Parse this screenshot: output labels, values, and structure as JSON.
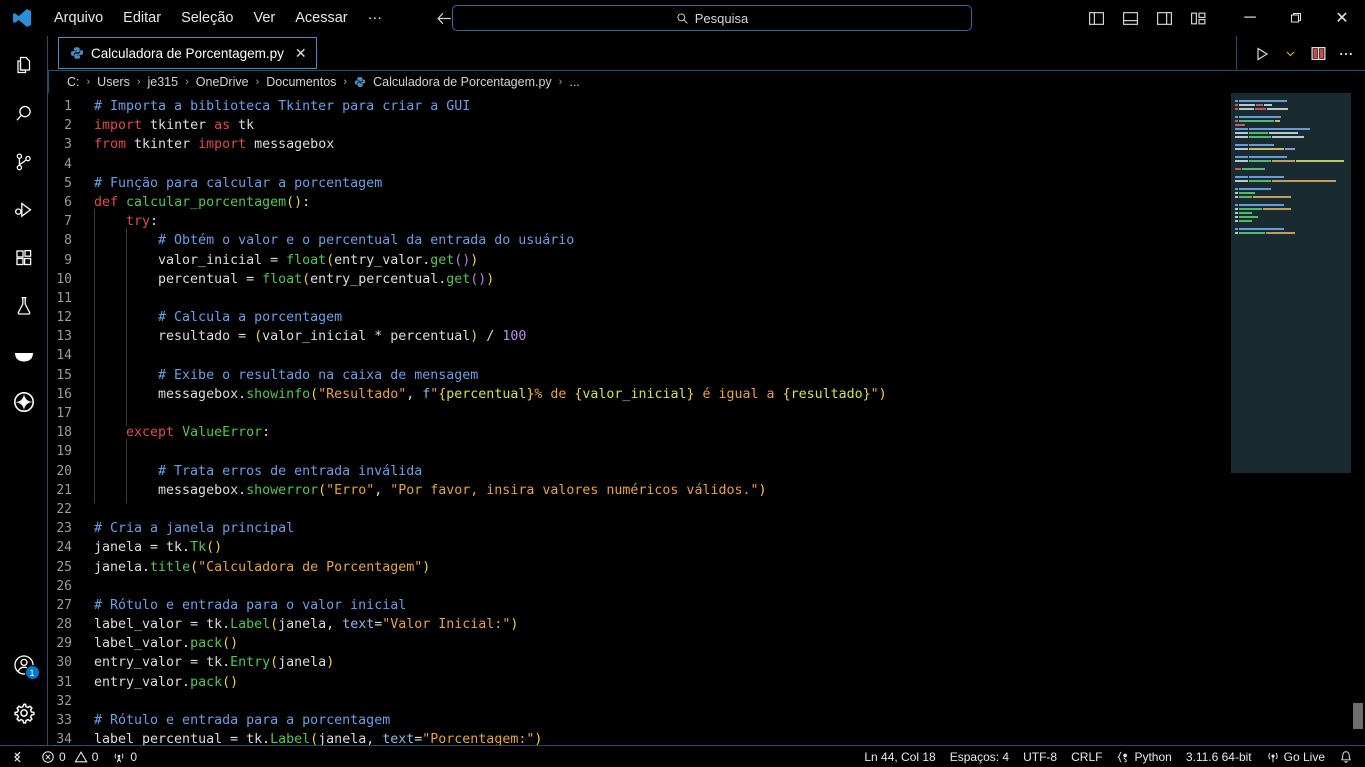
{
  "window": {
    "logo": "vscode-logo",
    "menu": [
      "Arquivo",
      "Editar",
      "Seleção",
      "Ver",
      "Acessar",
      "···"
    ],
    "nav": {
      "back": "back-arrow",
      "forward": "forward-arrow"
    },
    "search": {
      "placeholder": "Pesquisa",
      "value": "Pesquisa",
      "icon": "search-icon"
    },
    "layout_toggles": [
      {
        "name": "toggle-primary-sidebar",
        "label": "Alternar Barra Lateral Primária"
      },
      {
        "name": "toggle-panel",
        "label": "Alternar Painel"
      },
      {
        "name": "toggle-secondary-sidebar",
        "label": "Alternar Barra Lateral Secundária"
      },
      {
        "name": "customize-layout",
        "label": "Personalizar Layout"
      }
    ],
    "controls": {
      "minimize": "─",
      "maximize": "❐",
      "close": "✕"
    }
  },
  "activitybar": {
    "items": [
      {
        "name": "explorer",
        "icon": "files-icon",
        "label": "Explorador"
      },
      {
        "name": "search",
        "icon": "search-icon",
        "label": "Pesquisar"
      },
      {
        "name": "source-control",
        "icon": "source-control-icon",
        "label": "Controle do Código-Fonte"
      },
      {
        "name": "run-debug",
        "icon": "run-and-debug-icon",
        "label": "Executar e Depurar"
      },
      {
        "name": "extensions",
        "icon": "extensions-icon",
        "label": "Extensões"
      },
      {
        "name": "testing",
        "icon": "beaker-icon",
        "label": "Testes"
      },
      {
        "name": "docker",
        "icon": "docker-whale-icon",
        "label": "Docker"
      },
      {
        "name": "azure",
        "icon": "azure-swirl-icon",
        "label": "Azure"
      }
    ],
    "bottom": [
      {
        "name": "accounts",
        "icon": "account-icon",
        "label": "Contas",
        "badge": "1"
      },
      {
        "name": "settings",
        "icon": "gear-icon",
        "label": "Gerenciar"
      }
    ]
  },
  "tabs": [
    {
      "label": "Calculadora de Porcentagem.py",
      "icon": "python-file-icon",
      "close": "✕",
      "active": true
    }
  ],
  "editor_actions": [
    {
      "name": "run-python-file",
      "icon": "play-icon"
    },
    {
      "name": "run-options-dropdown",
      "icon": "chevron-down-icon"
    },
    {
      "name": "split-editor-right",
      "icon": "split-editor-icon"
    },
    {
      "name": "more-actions",
      "icon": "ellipsis-icon"
    }
  ],
  "breadcrumbs": {
    "items": [
      "C:",
      "Users",
      "je315",
      "OneDrive",
      "Documentos",
      "Calculadora de Porcentagem.py",
      "..."
    ],
    "separator": "›",
    "file_icon": "python-file-icon"
  },
  "statusbar": {
    "remote_icon": "remote-indicator-icon",
    "problems": {
      "error_icon": "error-icon",
      "errors": "0",
      "warning_icon": "warning-icon",
      "warnings": "0"
    },
    "ports": {
      "icon": "ports-icon",
      "count": "0"
    },
    "cursor": "Ln 44, Col 18",
    "indent": "Espaços: 4",
    "encoding": "UTF-8",
    "eol": "CRLF",
    "language": "Python",
    "language_icon": "python-brackets-icon",
    "interpreter": "3.11.6 64-bit",
    "golive": "Go Live",
    "golive_icon": "broadcast-icon",
    "notifications_icon": "bell-icon"
  },
  "colors": {
    "accent": "#0078d4",
    "tab_border": "#3d8ec9",
    "panel_border": "#1d4f6e",
    "background": "#000000",
    "comment": "#6a9fe8",
    "keyword": "#e04a4a",
    "function": "#4ec94e",
    "string": "#e8a33d",
    "number": "#b98cf0",
    "bracket": "#f2d13b",
    "fstring_expr": "#d7e04a"
  },
  "code": {
    "language": "python",
    "first_line": 1,
    "lines": [
      {
        "n": 1,
        "indent": 0,
        "tokens": [
          [
            "com",
            "# Importa a biblioteca Tkinter para criar a GUI"
          ]
        ]
      },
      {
        "n": 2,
        "indent": 0,
        "tokens": [
          [
            "kw",
            "import"
          ],
          [
            "pln",
            " tkinter "
          ],
          [
            "kw",
            "as"
          ],
          [
            "pln",
            " tk"
          ]
        ]
      },
      {
        "n": 3,
        "indent": 0,
        "tokens": [
          [
            "kw",
            "from"
          ],
          [
            "pln",
            " tkinter "
          ],
          [
            "kw",
            "import"
          ],
          [
            "pln",
            " messagebox"
          ]
        ]
      },
      {
        "n": 4,
        "indent": 0,
        "tokens": []
      },
      {
        "n": 5,
        "indent": 0,
        "tokens": [
          [
            "com",
            "# Função para calcular a porcentagem"
          ]
        ]
      },
      {
        "n": 6,
        "indent": 0,
        "tokens": [
          [
            "kw",
            "def"
          ],
          [
            "pln",
            " "
          ],
          [
            "fn",
            "calcular_porcentagem"
          ],
          [
            "par",
            "()"
          ],
          [
            "pln",
            ":"
          ]
        ]
      },
      {
        "n": 7,
        "indent": 1,
        "tokens": [
          [
            "kw",
            "try"
          ],
          [
            "pln",
            ":"
          ]
        ]
      },
      {
        "n": 8,
        "indent": 2,
        "tokens": [
          [
            "com",
            "# Obtém o valor e o percentual da entrada do usuário"
          ]
        ]
      },
      {
        "n": 9,
        "indent": 2,
        "tokens": [
          [
            "pln",
            "valor_inicial = "
          ],
          [
            "fn",
            "float"
          ],
          [
            "par",
            "("
          ],
          [
            "pln",
            "entry_valor."
          ],
          [
            "fn",
            "get"
          ],
          [
            "par2",
            "()"
          ],
          [
            "par",
            ")"
          ]
        ]
      },
      {
        "n": 10,
        "indent": 2,
        "tokens": [
          [
            "pln",
            "percentual = "
          ],
          [
            "fn",
            "float"
          ],
          [
            "par",
            "("
          ],
          [
            "pln",
            "entry_percentual."
          ],
          [
            "fn",
            "get"
          ],
          [
            "par2",
            "()"
          ],
          [
            "par",
            ")"
          ]
        ]
      },
      {
        "n": 11,
        "indent": 2,
        "tokens": []
      },
      {
        "n": 12,
        "indent": 2,
        "tokens": [
          [
            "com",
            "# Calcula a porcentagem"
          ]
        ]
      },
      {
        "n": 13,
        "indent": 2,
        "tokens": [
          [
            "pln",
            "resultado = "
          ],
          [
            "par",
            "("
          ],
          [
            "pln",
            "valor_inicial * percentual"
          ],
          [
            "par",
            ")"
          ],
          [
            "pln",
            " / "
          ],
          [
            "num",
            "100"
          ]
        ]
      },
      {
        "n": 14,
        "indent": 2,
        "tokens": []
      },
      {
        "n": 15,
        "indent": 2,
        "tokens": [
          [
            "com",
            "# Exibe o resultado na caixa de mensagem"
          ]
        ]
      },
      {
        "n": 16,
        "indent": 2,
        "tokens": [
          [
            "pln",
            "messagebox."
          ],
          [
            "fn",
            "showinfo"
          ],
          [
            "par",
            "("
          ],
          [
            "str",
            "\"Resultado\""
          ],
          [
            "pln",
            ", "
          ],
          [
            "prop",
            "f"
          ],
          [
            "str",
            "\""
          ],
          [
            "par",
            "{"
          ],
          [
            "fstr",
            "percentual"
          ],
          [
            "par",
            "}"
          ],
          [
            "str",
            "% de "
          ],
          [
            "par",
            "{"
          ],
          [
            "fstr",
            "valor_inicial"
          ],
          [
            "par",
            "}"
          ],
          [
            "str",
            " é igual a "
          ],
          [
            "par",
            "{"
          ],
          [
            "fstr",
            "resultado"
          ],
          [
            "par",
            "}"
          ],
          [
            "str",
            "\""
          ],
          [
            "par",
            ")"
          ]
        ]
      },
      {
        "n": 17,
        "indent": 2,
        "tokens": []
      },
      {
        "n": 18,
        "indent": 1,
        "tokens": [
          [
            "kw",
            "except"
          ],
          [
            "pln",
            " "
          ],
          [
            "cls",
            "ValueError"
          ],
          [
            "pln",
            ":"
          ]
        ]
      },
      {
        "n": 19,
        "indent": 2,
        "tokens": []
      },
      {
        "n": 20,
        "indent": 2,
        "tokens": [
          [
            "com",
            "# Trata erros de entrada inválida"
          ]
        ]
      },
      {
        "n": 21,
        "indent": 2,
        "tokens": [
          [
            "pln",
            "messagebox."
          ],
          [
            "fn",
            "showerror"
          ],
          [
            "par",
            "("
          ],
          [
            "str",
            "\"Erro\""
          ],
          [
            "pln",
            ", "
          ],
          [
            "str",
            "\"Por favor, insira valores numéricos válidos.\""
          ],
          [
            "par",
            ")"
          ]
        ]
      },
      {
        "n": 22,
        "indent": 0,
        "tokens": []
      },
      {
        "n": 23,
        "indent": 0,
        "tokens": [
          [
            "com",
            "# Cria a janela principal"
          ]
        ]
      },
      {
        "n": 24,
        "indent": 0,
        "tokens": [
          [
            "pln",
            "janela = tk."
          ],
          [
            "fn",
            "Tk"
          ],
          [
            "par",
            "()"
          ]
        ]
      },
      {
        "n": 25,
        "indent": 0,
        "tokens": [
          [
            "pln",
            "janela."
          ],
          [
            "fn",
            "title"
          ],
          [
            "par",
            "("
          ],
          [
            "str",
            "\"Calculadora de Porcentagem\""
          ],
          [
            "par",
            ")"
          ]
        ]
      },
      {
        "n": 26,
        "indent": 0,
        "tokens": []
      },
      {
        "n": 27,
        "indent": 0,
        "tokens": [
          [
            "com",
            "# Rótulo e entrada para o valor inicial"
          ]
        ]
      },
      {
        "n": 28,
        "indent": 0,
        "tokens": [
          [
            "pln",
            "label_valor = tk."
          ],
          [
            "fn",
            "Label"
          ],
          [
            "par",
            "("
          ],
          [
            "pln",
            "janela, "
          ],
          [
            "prop",
            "text"
          ],
          [
            "pln",
            "="
          ],
          [
            "str",
            "\"Valor Inicial:\""
          ],
          [
            "par",
            ")"
          ]
        ]
      },
      {
        "n": 29,
        "indent": 0,
        "tokens": [
          [
            "pln",
            "label_valor."
          ],
          [
            "fn",
            "pack"
          ],
          [
            "par",
            "()"
          ]
        ]
      },
      {
        "n": 30,
        "indent": 0,
        "tokens": [
          [
            "pln",
            "entry_valor = tk."
          ],
          [
            "fn",
            "Entry"
          ],
          [
            "par",
            "("
          ],
          [
            "pln",
            "janela"
          ],
          [
            "par",
            ")"
          ]
        ]
      },
      {
        "n": 31,
        "indent": 0,
        "tokens": [
          [
            "pln",
            "entry_valor."
          ],
          [
            "fn",
            "pack"
          ],
          [
            "par",
            "()"
          ]
        ]
      },
      {
        "n": 32,
        "indent": 0,
        "tokens": []
      },
      {
        "n": 33,
        "indent": 0,
        "tokens": [
          [
            "com",
            "# Rótulo e entrada para a porcentagem"
          ]
        ]
      },
      {
        "n": 34,
        "indent": 0,
        "tokens": [
          [
            "pln",
            "label_percentual = tk."
          ],
          [
            "fn",
            "Label"
          ],
          [
            "par",
            "("
          ],
          [
            "pln",
            "janela, "
          ],
          [
            "prop",
            "text"
          ],
          [
            "pln",
            "="
          ],
          [
            "str",
            "\"Porcentagem:\""
          ],
          [
            "par",
            ")"
          ]
        ]
      }
    ]
  },
  "minimap": {
    "slider_top": 0,
    "slider_height": 380,
    "rows": [
      [
        [
          2,
          "#6a9fe8"
        ],
        [
          30,
          "#6a9fe8"
        ]
      ],
      [
        [
          2,
          "#e04a4a"
        ],
        [
          10,
          "#dcdcdc"
        ],
        [
          4,
          "#e04a4a"
        ],
        [
          5,
          "#dcdcdc"
        ]
      ],
      [
        [
          2,
          "#e04a4a"
        ],
        [
          9,
          "#dcdcdc"
        ],
        [
          7,
          "#e04a4a"
        ],
        [
          13,
          "#dcdcdc"
        ]
      ],
      [],
      [
        [
          2,
          "#6a9fe8"
        ],
        [
          26,
          "#6a9fe8"
        ]
      ],
      [
        [
          2,
          "#e04a4a"
        ],
        [
          22,
          "#4ec94e"
        ],
        [
          3,
          "#f2d13b"
        ]
      ],
      [
        [
          6,
          "#e04a4a"
        ]
      ],
      [
        [
          8,
          "#6a9fe8"
        ],
        [
          38,
          "#6a9fe8"
        ]
      ],
      [
        [
          8,
          "#dcdcdc"
        ],
        [
          12,
          "#4ec94e"
        ],
        [
          18,
          "#dcdcdc"
        ]
      ],
      [
        [
          8,
          "#dcdcdc"
        ],
        [
          14,
          "#4ec94e"
        ],
        [
          20,
          "#dcdcdc"
        ]
      ],
      [],
      [
        [
          8,
          "#6a9fe8"
        ],
        [
          16,
          "#6a9fe8"
        ]
      ],
      [
        [
          8,
          "#dcdcdc"
        ],
        [
          22,
          "#f2d13b"
        ],
        [
          6,
          "#b98cf0"
        ]
      ],
      [],
      [
        [
          8,
          "#6a9fe8"
        ],
        [
          24,
          "#6a9fe8"
        ]
      ],
      [
        [
          8,
          "#dcdcdc"
        ],
        [
          14,
          "#4ec94e"
        ],
        [
          14,
          "#e8a33d"
        ],
        [
          30,
          "#d7e04a"
        ]
      ],
      [],
      [
        [
          4,
          "#e04a4a"
        ],
        [
          14,
          "#4ec94e"
        ]
      ],
      [],
      [
        [
          8,
          "#6a9fe8"
        ],
        [
          22,
          "#6a9fe8"
        ]
      ],
      [
        [
          8,
          "#dcdcdc"
        ],
        [
          14,
          "#4ec94e"
        ],
        [
          40,
          "#e8a33d"
        ]
      ],
      [],
      [
        [
          2,
          "#6a9fe8"
        ],
        [
          20,
          "#6a9fe8"
        ]
      ],
      [
        [
          2,
          "#dcdcdc"
        ],
        [
          10,
          "#4ec94e"
        ]
      ],
      [
        [
          2,
          "#dcdcdc"
        ],
        [
          8,
          "#4ec94e"
        ],
        [
          24,
          "#e8a33d"
        ]
      ],
      [],
      [
        [
          2,
          "#6a9fe8"
        ],
        [
          28,
          "#6a9fe8"
        ]
      ],
      [
        [
          2,
          "#dcdcdc"
        ],
        [
          14,
          "#4ec94e"
        ],
        [
          18,
          "#e8a33d"
        ]
      ],
      [
        [
          2,
          "#dcdcdc"
        ],
        [
          8,
          "#4ec94e"
        ]
      ],
      [
        [
          2,
          "#dcdcdc"
        ],
        [
          12,
          "#4ec94e"
        ]
      ],
      [
        [
          2,
          "#dcdcdc"
        ],
        [
          8,
          "#4ec94e"
        ]
      ],
      [],
      [
        [
          2,
          "#6a9fe8"
        ],
        [
          28,
          "#6a9fe8"
        ]
      ],
      [
        [
          2,
          "#dcdcdc"
        ],
        [
          16,
          "#4ec94e"
        ],
        [
          18,
          "#e8a33d"
        ]
      ]
    ]
  }
}
